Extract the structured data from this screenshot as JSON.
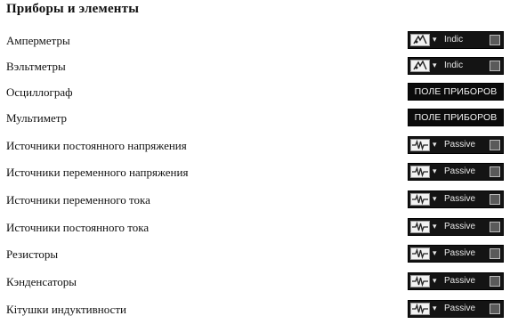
{
  "title": "Приборы и элементы",
  "rows": [
    {
      "label": "Амперметры",
      "control": {
        "kind": "indicator",
        "icon": "meter-icon",
        "dropdown": "▾",
        "value": "Indic"
      }
    },
    {
      "label": "Вэльтметры",
      "control": {
        "kind": "indicator",
        "icon": "meter-icon",
        "dropdown": "▾",
        "value": "Indic"
      }
    },
    {
      "label": "Осциллограф",
      "control": {
        "kind": "panel",
        "value": "ПОЛЕ ПРИБОРОВ"
      }
    },
    {
      "label": "Мультиметр",
      "control": {
        "kind": "panel",
        "value": "ПОЛЕ ПРИБОРОВ"
      }
    },
    {
      "label": "Источники постоянного напряжения",
      "control": {
        "kind": "passive",
        "icon": "resistor-icon",
        "dropdown": "▾",
        "value": "Passive"
      }
    },
    {
      "label": "Источники переменного напряжения",
      "control": {
        "kind": "passive",
        "icon": "resistor-icon",
        "dropdown": "▾",
        "value": "Passive"
      }
    },
    {
      "label": "Источники переменного тока",
      "control": {
        "kind": "passive",
        "icon": "resistor-icon",
        "dropdown": "▾",
        "value": "Passive"
      }
    },
    {
      "label": "Источники постоянного тока",
      "control": {
        "kind": "passive",
        "icon": "resistor-icon",
        "dropdown": "▾",
        "value": "Passive"
      }
    },
    {
      "label": "Резисторы",
      "control": {
        "kind": "passive",
        "icon": "resistor-icon",
        "dropdown": "▾",
        "value": "Passive"
      }
    },
    {
      "label": "Кэнденсаторы",
      "control": {
        "kind": "passive",
        "icon": "resistor-icon",
        "dropdown": "▾",
        "value": "Passive"
      }
    },
    {
      "label": "Кітушки индуктивности",
      "control": {
        "kind": "passive",
        "icon": "resistor-icon",
        "dropdown": "▾",
        "value": "Passive"
      }
    }
  ]
}
